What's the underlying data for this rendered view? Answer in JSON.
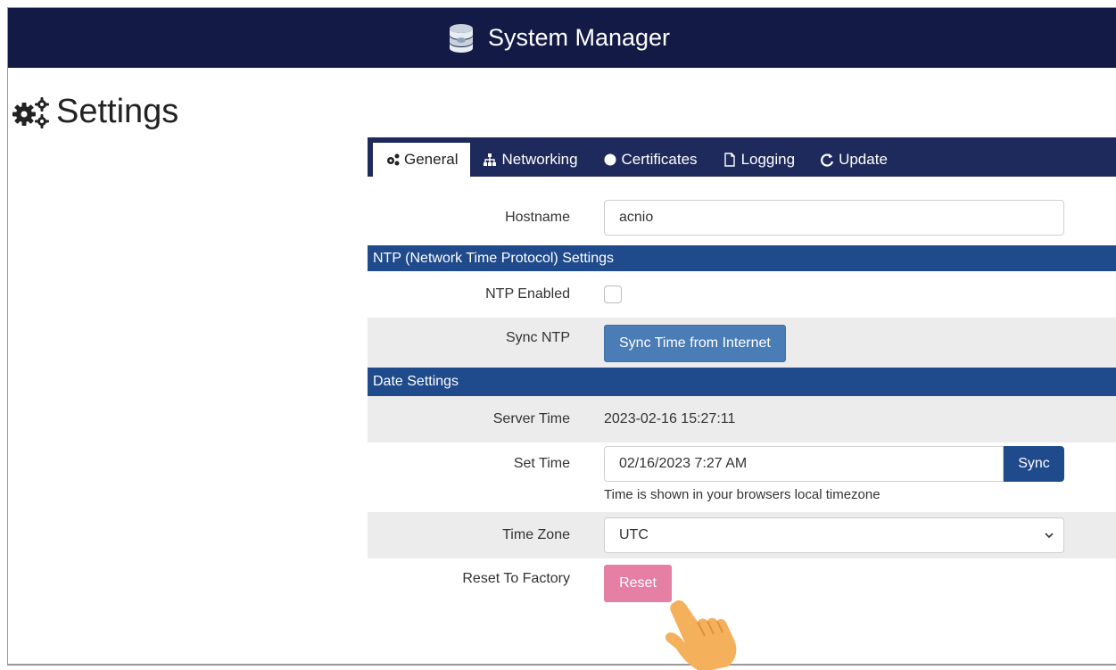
{
  "app": {
    "title": "System Manager"
  },
  "page": {
    "title": "Settings"
  },
  "tabs": [
    {
      "label": "General",
      "icon": "gears-icon",
      "active": true
    },
    {
      "label": "Networking",
      "icon": "sitemap-icon",
      "active": false
    },
    {
      "label": "Certificates",
      "icon": "certificate-icon",
      "active": false
    },
    {
      "label": "Logging",
      "icon": "file-icon",
      "active": false
    },
    {
      "label": "Update",
      "icon": "refresh-icon",
      "active": false
    }
  ],
  "general": {
    "hostname": {
      "label": "Hostname",
      "value": "acnio"
    },
    "ntp": {
      "section_title": "NTP (Network Time Protocol) Settings",
      "enabled_label": "NTP Enabled",
      "enabled": false,
      "sync_label": "Sync NTP",
      "sync_button": "Sync Time from Internet"
    },
    "date": {
      "section_title": "Date Settings",
      "server_time_label": "Server Time",
      "server_time": "2023-02-16 15:27:11",
      "set_time_label": "Set Time",
      "set_time_value": "02/16/2023 7:27 AM",
      "sync_button": "Sync",
      "help": "Time is shown in your browsers local timezone",
      "timezone_label": "Time Zone",
      "timezone_value": "UTC"
    },
    "reset": {
      "label": "Reset To Factory",
      "button": "Reset"
    }
  },
  "colors": {
    "topbar": "#131a45",
    "tabbar": "#1f2a5c",
    "section": "#1f4a8b",
    "primary_button": "#4a7db6",
    "reset_button": "#e57fa3",
    "hand": "#f5b05b"
  }
}
